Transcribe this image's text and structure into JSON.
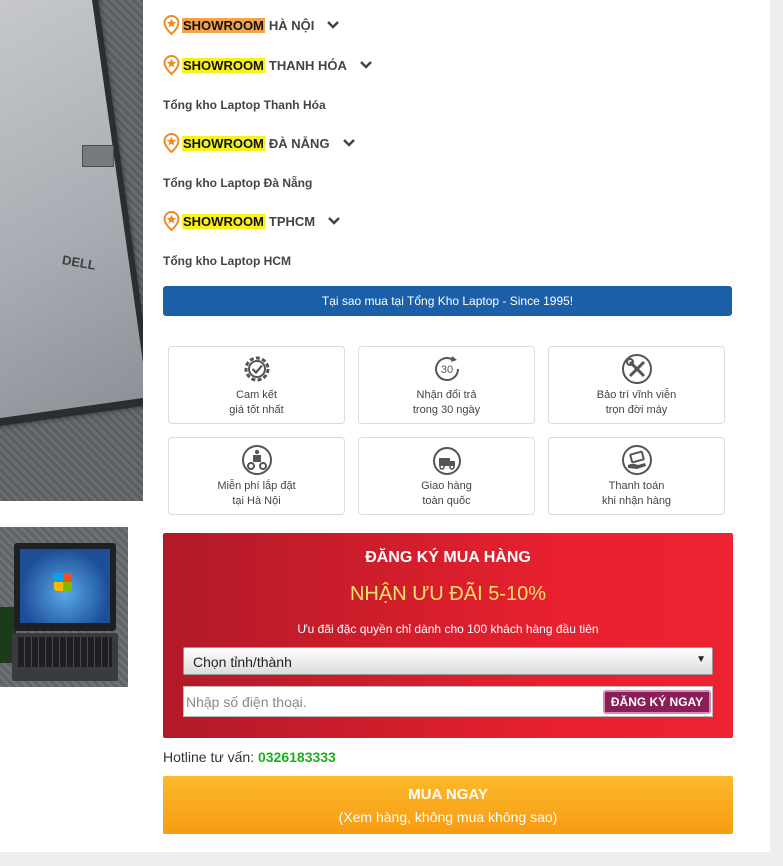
{
  "showrooms": [
    {
      "tag": "SHOWROOM",
      "city": "HÀ NỘI",
      "warehouse": ""
    },
    {
      "tag": "SHOWROOM",
      "city": "THANH HÓA",
      "warehouse": "Tổng kho Laptop Thanh Hóa"
    },
    {
      "tag": "SHOWROOM",
      "city": "ĐÀ NẴNG",
      "warehouse": "Tổng kho Laptop Đà Nẵng"
    },
    {
      "tag": "SHOWROOM",
      "city": "TPHCM",
      "warehouse": "Tổng kho Laptop HCM"
    }
  ],
  "images": {
    "logo_text": "DELL"
  },
  "why_bar": "Tại sao mua tại Tổng Kho Laptop - Since 1995!",
  "features": [
    {
      "icon": "check-gear-icon",
      "line1": "Cam kết",
      "line2": "giá tốt nhất"
    },
    {
      "icon": "return-30-icon",
      "line1": "Nhận đổi trả",
      "line2": "trong 30 ngày"
    },
    {
      "icon": "tools-icon",
      "line1": "Bảo trì vĩnh viễn",
      "line2": "trọn đời máy"
    },
    {
      "icon": "delivery-scooter-icon",
      "line1": "Miễn phí lắp đặt",
      "line2": "tại Hà Nội"
    },
    {
      "icon": "free-truck-icon",
      "line1": "Giao hàng",
      "line2": "toàn quốc"
    },
    {
      "icon": "cash-hand-icon",
      "line1": "Thanh toán",
      "line2": "khi nhận hàng"
    }
  ],
  "register": {
    "title": "ĐĂNG KÝ MUA HÀNG",
    "offer": "NHẬN ƯU ĐÃI 5-10%",
    "note": "Ưu đãi đặc quyền chỉ dành cho 100 khách hàng đầu tiên",
    "select_value": "Chọn tỉnh/thành",
    "phone_placeholder": "Nhập số điện thoại.",
    "submit_label": "ĐĂNG KÝ NGAY"
  },
  "hotline": {
    "label": "Hotline tư vấn:",
    "number": "0326183333"
  },
  "buy": {
    "label": "MUA NGAY",
    "sub": "(Xem hàng, không mua không sao)"
  },
  "colors": {
    "accent_blue": "#1b5fa8",
    "register_red": "#e9202f",
    "buy_orange": "#f79b12",
    "hotline_green": "#1bb01b",
    "tag_yellow": "#f7f31a",
    "tag_orange": "#f5a24a"
  }
}
